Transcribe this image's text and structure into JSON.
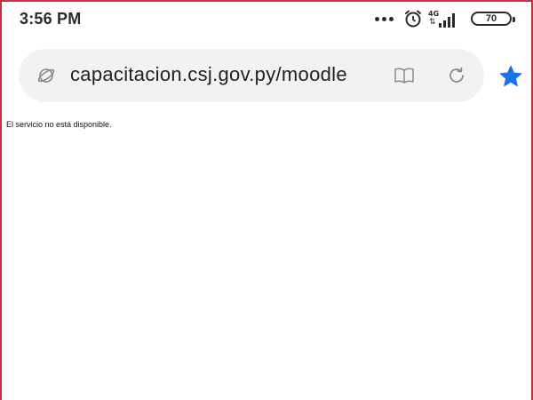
{
  "status_bar": {
    "time": "3:56 PM",
    "network_type": "4G",
    "battery_level": "70",
    "icons": [
      "more-dots-icon",
      "alarm-icon",
      "signal-icon",
      "battery-icon"
    ]
  },
  "browser": {
    "url": "capacitacion.csj.gov.py/moodle",
    "icons": [
      "site-info-icon",
      "reader-mode-icon",
      "reload-icon",
      "bookmark-star-icon"
    ],
    "accent_color": "#1a73e8"
  },
  "page": {
    "message": "El servicio no está disponible."
  },
  "colors": {
    "frame_border": "#c8313b",
    "url_bar_bg": "#f2f2f2",
    "text": "#2a2a2a"
  }
}
